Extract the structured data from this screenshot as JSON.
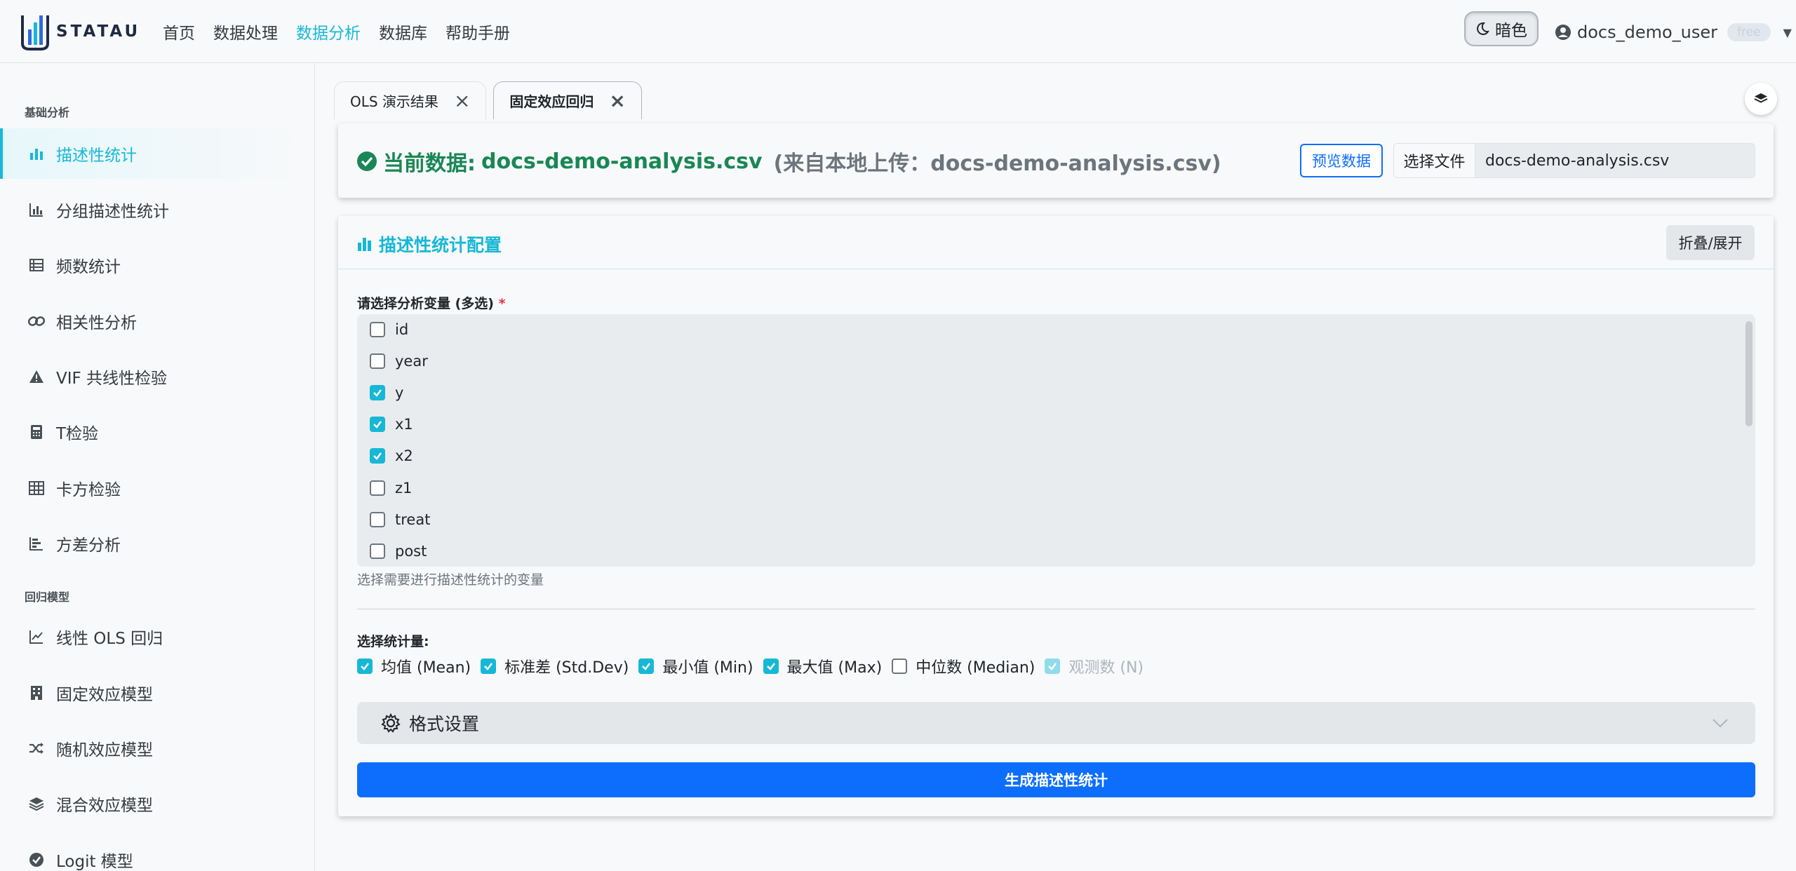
{
  "brand": {
    "name": "STATAU"
  },
  "nav": {
    "links": [
      "首页",
      "数据处理",
      "数据分析",
      "数据库",
      "帮助手册"
    ],
    "active_index": 2
  },
  "theme_toggle": {
    "label": "暗色",
    "icon": "moon-icon"
  },
  "user": {
    "name": "docs_demo_user",
    "plan": "free"
  },
  "sidebar": {
    "section_basic": "基础分析",
    "section_regression": "回归模型",
    "items": [
      {
        "label": "描述性统计",
        "icon": "bar-chart-icon",
        "active": true
      },
      {
        "label": "分组描述性统计",
        "icon": "grouped-bar-chart-icon"
      },
      {
        "label": "频数统计",
        "icon": "table-list-icon"
      },
      {
        "label": "相关性分析",
        "icon": "link-icon"
      },
      {
        "label": "VIF 共线性检验",
        "icon": "warning-triangle-icon"
      },
      {
        "label": "T检验",
        "icon": "calculator-icon"
      },
      {
        "label": "卡方检验",
        "icon": "grid-table-icon"
      },
      {
        "label": "方差分析",
        "icon": "bar-chart-steps-icon"
      },
      {
        "label": "线性 OLS 回归",
        "icon": "line-chart-icon"
      },
      {
        "label": "固定效应模型",
        "icon": "building-icon"
      },
      {
        "label": "随机效应模型",
        "icon": "shuffle-icon"
      },
      {
        "label": "混合效应模型",
        "icon": "layers-icon"
      },
      {
        "label": "Logit 模型",
        "icon": "check-circle-icon"
      }
    ]
  },
  "tabs": [
    {
      "label": "OLS 演示结果",
      "active": false
    },
    {
      "label": "固定效应回归",
      "active": true
    }
  ],
  "data_card": {
    "prefix": "当前数据:",
    "filename": "docs-demo-analysis.csv",
    "source": "(来自本地上传：docs-demo-analysis.csv)",
    "preview_label": "预览数据",
    "choose_file_label": "选择文件",
    "file_value": "docs-demo-analysis.csv"
  },
  "config": {
    "title": "描述性统计配置",
    "collapse_label": "折叠/展开",
    "variables_label": "请选择分析变量 (多选)",
    "required_mark": "*",
    "variables": [
      {
        "name": "id",
        "checked": false
      },
      {
        "name": "year",
        "checked": false
      },
      {
        "name": "y",
        "checked": true
      },
      {
        "name": "x1",
        "checked": true
      },
      {
        "name": "x2",
        "checked": true
      },
      {
        "name": "z1",
        "checked": false
      },
      {
        "name": "treat",
        "checked": false
      },
      {
        "name": "post",
        "checked": false
      }
    ],
    "variables_help": "选择需要进行描述性统计的变量",
    "stats_label": "选择统计量:",
    "stats": [
      {
        "label": "均值 (Mean)",
        "checked": true,
        "disabled": false
      },
      {
        "label": "标准差 (Std.Dev)",
        "checked": true,
        "disabled": false
      },
      {
        "label": "最小值 (Min)",
        "checked": true,
        "disabled": false
      },
      {
        "label": "最大值 (Max)",
        "checked": true,
        "disabled": false
      },
      {
        "label": "中位数 (Median)",
        "checked": false,
        "disabled": false
      },
      {
        "label": "观测数 (N)",
        "checked": true,
        "disabled": true
      }
    ],
    "format_label": "格式设置",
    "generate_label": "生成描述性统计"
  },
  "colors": {
    "accent": "#17b8d6",
    "primary": "#0d6efd",
    "success": "#198754"
  }
}
